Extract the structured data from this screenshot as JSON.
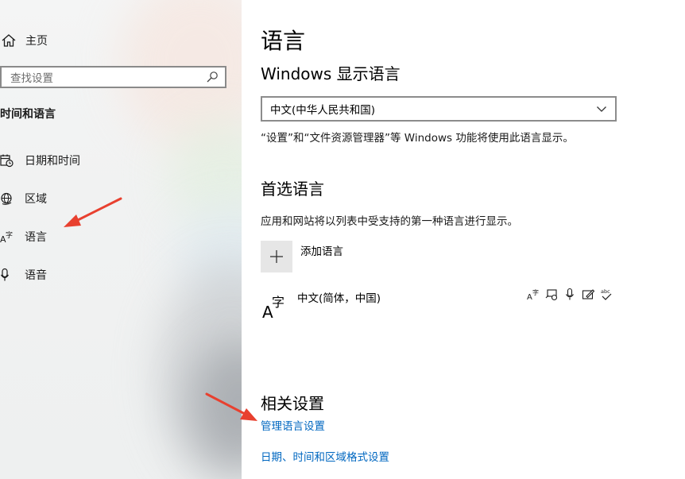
{
  "sidebar": {
    "home_label": "主页",
    "search_placeholder": "查找设置",
    "section_title": "时间和语言",
    "items": [
      {
        "label": "日期和时间",
        "icon": "calendar-clock-icon"
      },
      {
        "label": "区域",
        "icon": "globe-icon"
      },
      {
        "label": "语言",
        "icon": "language-icon"
      },
      {
        "label": "语音",
        "icon": "microphone-icon"
      }
    ]
  },
  "main": {
    "title": "语言",
    "display_language": {
      "heading": "Windows 显示语言",
      "selected": "中文(中华人民共和国)",
      "description": "“设置”和“文件资源管理器”等 Windows 功能将使用此语言显示。"
    },
    "preferred": {
      "heading": "首选语言",
      "description": "应用和网站将以列表中受支持的第一种语言进行显示。",
      "add_label": "添加语言",
      "languages": [
        {
          "name": "中文(简体，中国)",
          "icon_text": "A字",
          "features": [
            "display-language-icon",
            "speech-recognition-icon",
            "microphone-icon",
            "handwriting-icon",
            "spellcheck-icon"
          ]
        }
      ]
    },
    "related": {
      "heading": "相关设置",
      "links": [
        "管理语言设置",
        "日期、时间和区域格式设置"
      ]
    }
  },
  "colors": {
    "link": "#0067c0",
    "annotation_arrow": "#e8402f"
  }
}
